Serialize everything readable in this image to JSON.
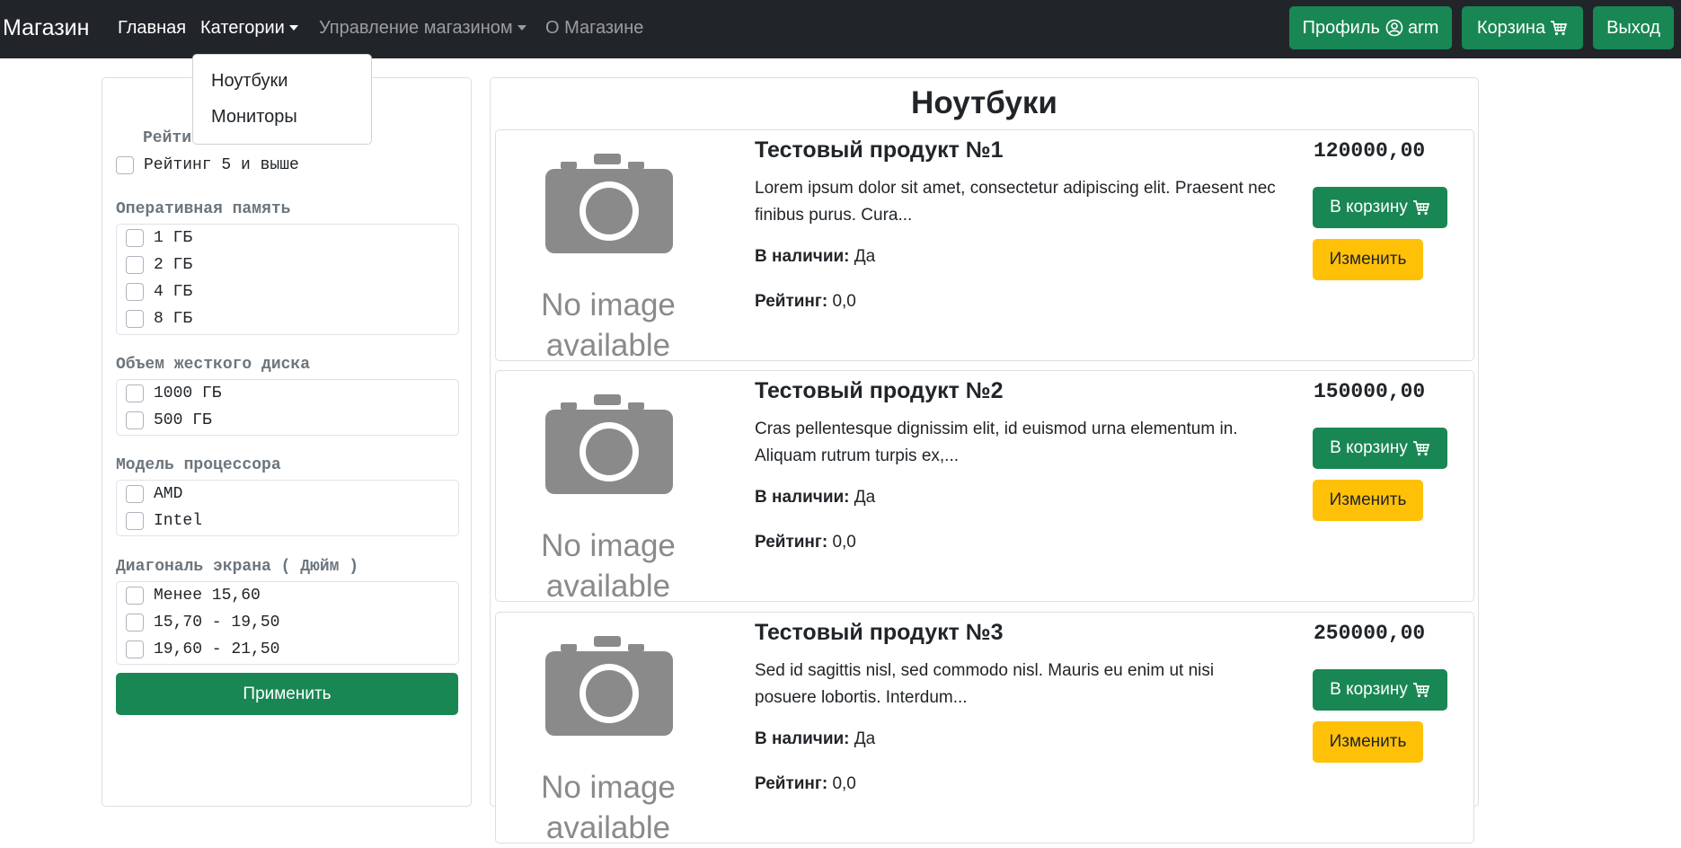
{
  "nav": {
    "brand": "Магазин",
    "links": [
      {
        "label": "Главная"
      },
      {
        "label": "Категории"
      },
      {
        "label": "Управление магазином"
      },
      {
        "label": "О Магазине"
      }
    ],
    "profile_label": "Профиль",
    "username": "arm",
    "cart_label": "Корзина",
    "logout_label": "Выход"
  },
  "dropdown": {
    "items": [
      {
        "label": "Ноутбуки"
      },
      {
        "label": "Мониторы"
      }
    ]
  },
  "filters": {
    "rating": {
      "title_visible": "Рейти",
      "options": [
        {
          "label": "Рейтинг 5 и выше",
          "checked": false
        }
      ]
    },
    "ram": {
      "title": "Оперативная память",
      "options": [
        {
          "label": "1 ГБ",
          "checked": false
        },
        {
          "label": "2 ГБ",
          "checked": false
        },
        {
          "label": "4 ГБ",
          "checked": false
        },
        {
          "label": "8 ГБ",
          "checked": false
        }
      ]
    },
    "disk": {
      "title": "Объем жесткого диска",
      "options": [
        {
          "label": "1000 ГБ",
          "checked": false
        },
        {
          "label": "500 ГБ",
          "checked": false
        }
      ]
    },
    "cpu": {
      "title": "Модель процессора",
      "options": [
        {
          "label": "AMD",
          "checked": false
        },
        {
          "label": "Intel",
          "checked": false
        }
      ]
    },
    "screen": {
      "title": "Диагональ экрана ( Дюйм )",
      "options": [
        {
          "label": "Менее 15,60",
          "checked": false
        },
        {
          "label": "15,70 - 19,50",
          "checked": false
        },
        {
          "label": "19,60 - 21,50",
          "checked": false
        }
      ]
    },
    "apply_label": "Применить"
  },
  "main": {
    "title": "Ноутбуки",
    "products": [
      {
        "image_text_line1": "No image",
        "image_text_line2": "available",
        "name": "Тестовый продукт №1",
        "description": "Lorem ipsum dolor sit amet, consectetur adipiscing elit. Praesent nec finibus purus. Cura...",
        "availability_label": "В наличии:",
        "availability_value": "Да",
        "rating_label": "Рейтинг:",
        "rating_value": "0,0",
        "price": "120000,00",
        "cart_button": "В корзину",
        "edit_button": "Изменить"
      },
      {
        "image_text_line1": "No image",
        "image_text_line2": "available",
        "name": "Тестовый продукт №2",
        "description": "Cras pellentesque dignissim elit, id euismod urna elementum in. Aliquam rutrum turpis ex,...",
        "availability_label": "В наличии:",
        "availability_value": "Да",
        "rating_label": "Рейтинг:",
        "rating_value": "0,0",
        "price": "150000,00",
        "cart_button": "В корзину",
        "edit_button": "Изменить"
      },
      {
        "image_text_line1": "No image",
        "image_text_line2": "available",
        "name": "Тестовый продукт №3",
        "description": "Sed id sagittis nisl, sed commodo nisl. Mauris eu enim ut nisi posuere lobortis. Interdum...",
        "availability_label": "В наличии:",
        "availability_value": "Да",
        "rating_label": "Рейтинг:",
        "rating_value": "0,0",
        "price": "250000,00",
        "cart_button": "В корзину",
        "edit_button": "Изменить"
      }
    ]
  },
  "colors": {
    "navbar": "#212529",
    "success": "#198754",
    "warning": "#ffc107",
    "muted": "#6c757d"
  },
  "icons": [
    "user-circle-icon",
    "cart-icon",
    "camera-icon",
    "caret-down-icon"
  ]
}
